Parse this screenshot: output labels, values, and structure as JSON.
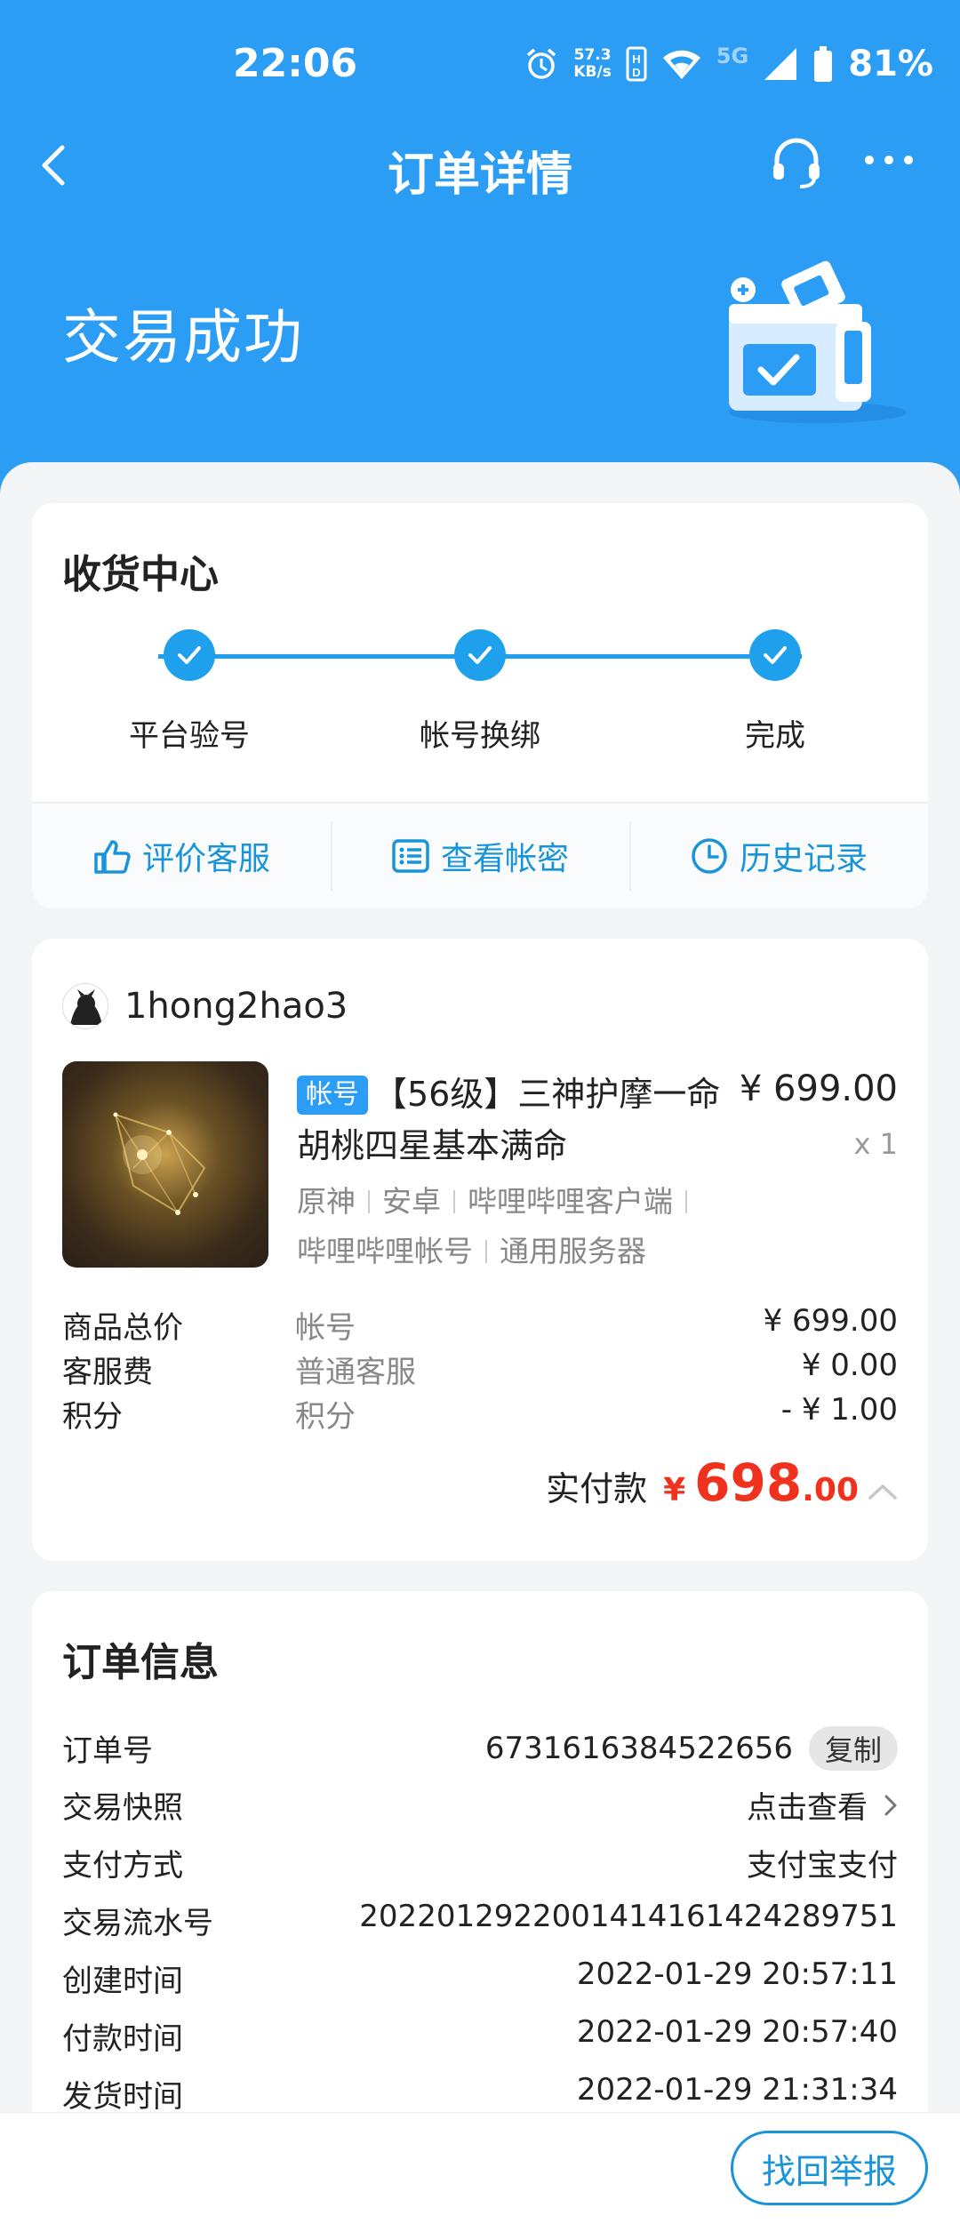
{
  "status_bar": {
    "time": "22:06",
    "net_speed_value": "57.3",
    "net_speed_unit": "KB/s",
    "network": "5G",
    "battery": "81%"
  },
  "nav": {
    "title": "订单详情",
    "icons": [
      "back-arrow-icon",
      "headset-icon",
      "more-icon"
    ]
  },
  "hero": {
    "status_title": "交易成功"
  },
  "delivery": {
    "title": "收货中心",
    "steps": [
      {
        "label": "平台验号",
        "done": true
      },
      {
        "label": "帐号换绑",
        "done": true
      },
      {
        "label": "完成",
        "done": true
      }
    ],
    "actions": [
      {
        "label": "评价客服",
        "icon": "thumbs-up-icon"
      },
      {
        "label": "查看帐密",
        "icon": "list-icon"
      },
      {
        "label": "历史记录",
        "icon": "clock-icon"
      }
    ]
  },
  "order_item": {
    "seller": "1hong2hao3",
    "tag": "帐号",
    "title": "【56级】三神护摩一命胡桃四星基本满命",
    "price": "¥ 699.00",
    "quantity": "x 1",
    "props_line1": [
      "原神",
      "安卓",
      "哔哩哔哩客户端"
    ],
    "props_line2": [
      "哔哩哔哩帐号",
      "通用服务器"
    ],
    "fees": [
      {
        "label": "商品总价",
        "sub": "帐号",
        "value": "¥ 699.00"
      },
      {
        "label": "客服费",
        "sub": "普通客服",
        "value": "¥ 0.00"
      },
      {
        "label": "积分",
        "sub": "积分",
        "value": "- ¥ 1.00"
      }
    ],
    "paid_label": "实付款",
    "paid_symbol": "¥",
    "paid_int": "698",
    "paid_dec": ".00"
  },
  "order_info": {
    "title": "订单信息",
    "rows": [
      {
        "label": "订单号",
        "value": "6731616384522656",
        "action": "复制"
      },
      {
        "label": "交易快照",
        "value": "点击查看"
      },
      {
        "label": "支付方式",
        "value": "支付宝支付"
      },
      {
        "label": "交易流水号",
        "value": "2022012922001414161424289751"
      },
      {
        "label": "创建时间",
        "value": "2022-01-29 20:57:11"
      },
      {
        "label": "付款时间",
        "value": "2022-01-29 20:57:40"
      },
      {
        "label": "发货时间",
        "value": "2022-01-29 21:31:34"
      }
    ]
  },
  "bottom": {
    "report_button": "找回举报"
  },
  "colors": {
    "brand_blue": "#2c9df5",
    "accent_blue": "#1a94d8",
    "price_red": "#f0311e"
  }
}
